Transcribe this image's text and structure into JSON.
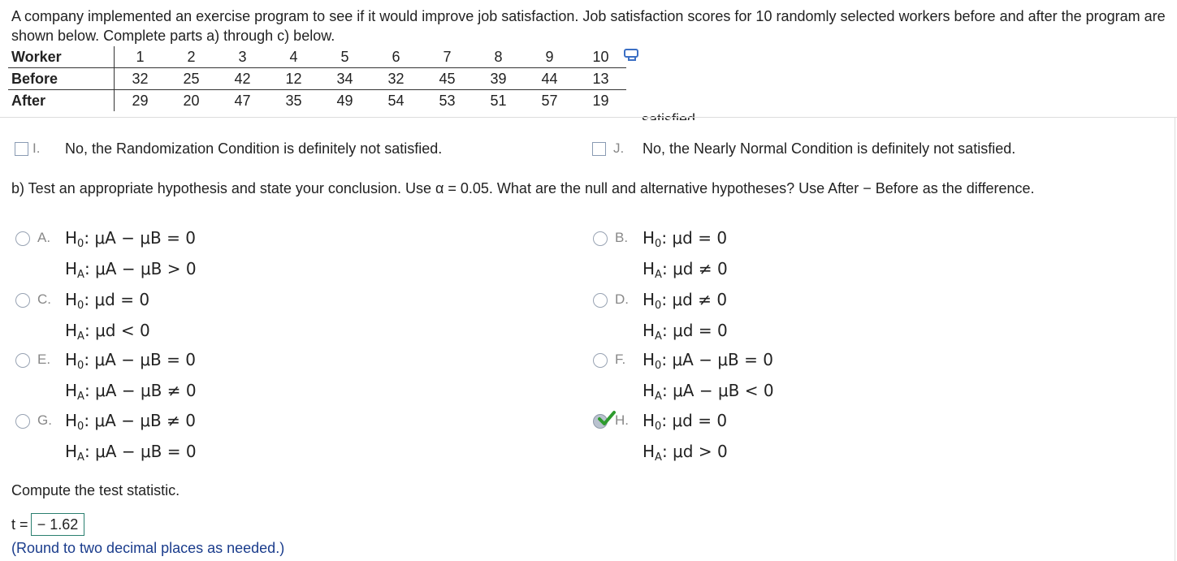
{
  "intro": "A company implemented an exercise program to see if it would improve job satisfaction. Job satisfaction scores for 10 randomly selected workers before and after the program are shown below. Complete parts a) through c) below.",
  "table": {
    "row_labels": [
      "Worker",
      "Before",
      "After"
    ],
    "workers": [
      "1",
      "2",
      "3",
      "4",
      "5",
      "6",
      "7",
      "8",
      "9",
      "10"
    ],
    "before": [
      "32",
      "25",
      "42",
      "12",
      "34",
      "32",
      "45",
      "39",
      "44",
      "13"
    ],
    "after": [
      "29",
      "20",
      "47",
      "35",
      "49",
      "54",
      "53",
      "51",
      "57",
      "19"
    ]
  },
  "cut_text": "satisfied.",
  "conditions": {
    "I": {
      "letter": "I.",
      "text": "No, the Randomization Condition is definitely not satisfied."
    },
    "J": {
      "letter": "J.",
      "text": "No, the Nearly Normal Condition is definitely not satisfied."
    }
  },
  "part_b": "b) Test an appropriate hypothesis and state your conclusion. Use α = 0.05. What are the null and alternative hypotheses? Use After − Before as the difference.",
  "options": {
    "A": {
      "letter": "A.",
      "h0": "μA − μB = 0",
      "ha": "μA − μB > 0"
    },
    "B": {
      "letter": "B.",
      "h0": "μd = 0",
      "ha": "μd ≠ 0"
    },
    "C": {
      "letter": "C.",
      "h0": "μd = 0",
      "ha": "μd < 0"
    },
    "D": {
      "letter": "D.",
      "h0": "μd ≠ 0",
      "ha": "μd = 0"
    },
    "E": {
      "letter": "E.",
      "h0": "μA − μB = 0",
      "ha": "μA − μB ≠ 0"
    },
    "F": {
      "letter": "F.",
      "h0": "μA − μB = 0",
      "ha": "μA − μB < 0"
    },
    "G": {
      "letter": "G.",
      "h0": "μA − μB ≠ 0",
      "ha": "μA − μB = 0"
    },
    "H": {
      "letter": "H.",
      "h0": "μd = 0",
      "ha": "μd > 0"
    }
  },
  "selected_option": "H",
  "compute_text": "Compute the test statistic.",
  "t_label": "t =",
  "t_value": "− 1.62",
  "round_note": "(Round to two decimal places as needed.)",
  "colors": {
    "check": "#2e9b2e",
    "note": "#1a3c8c",
    "answer_border": "#2a7f6f"
  }
}
